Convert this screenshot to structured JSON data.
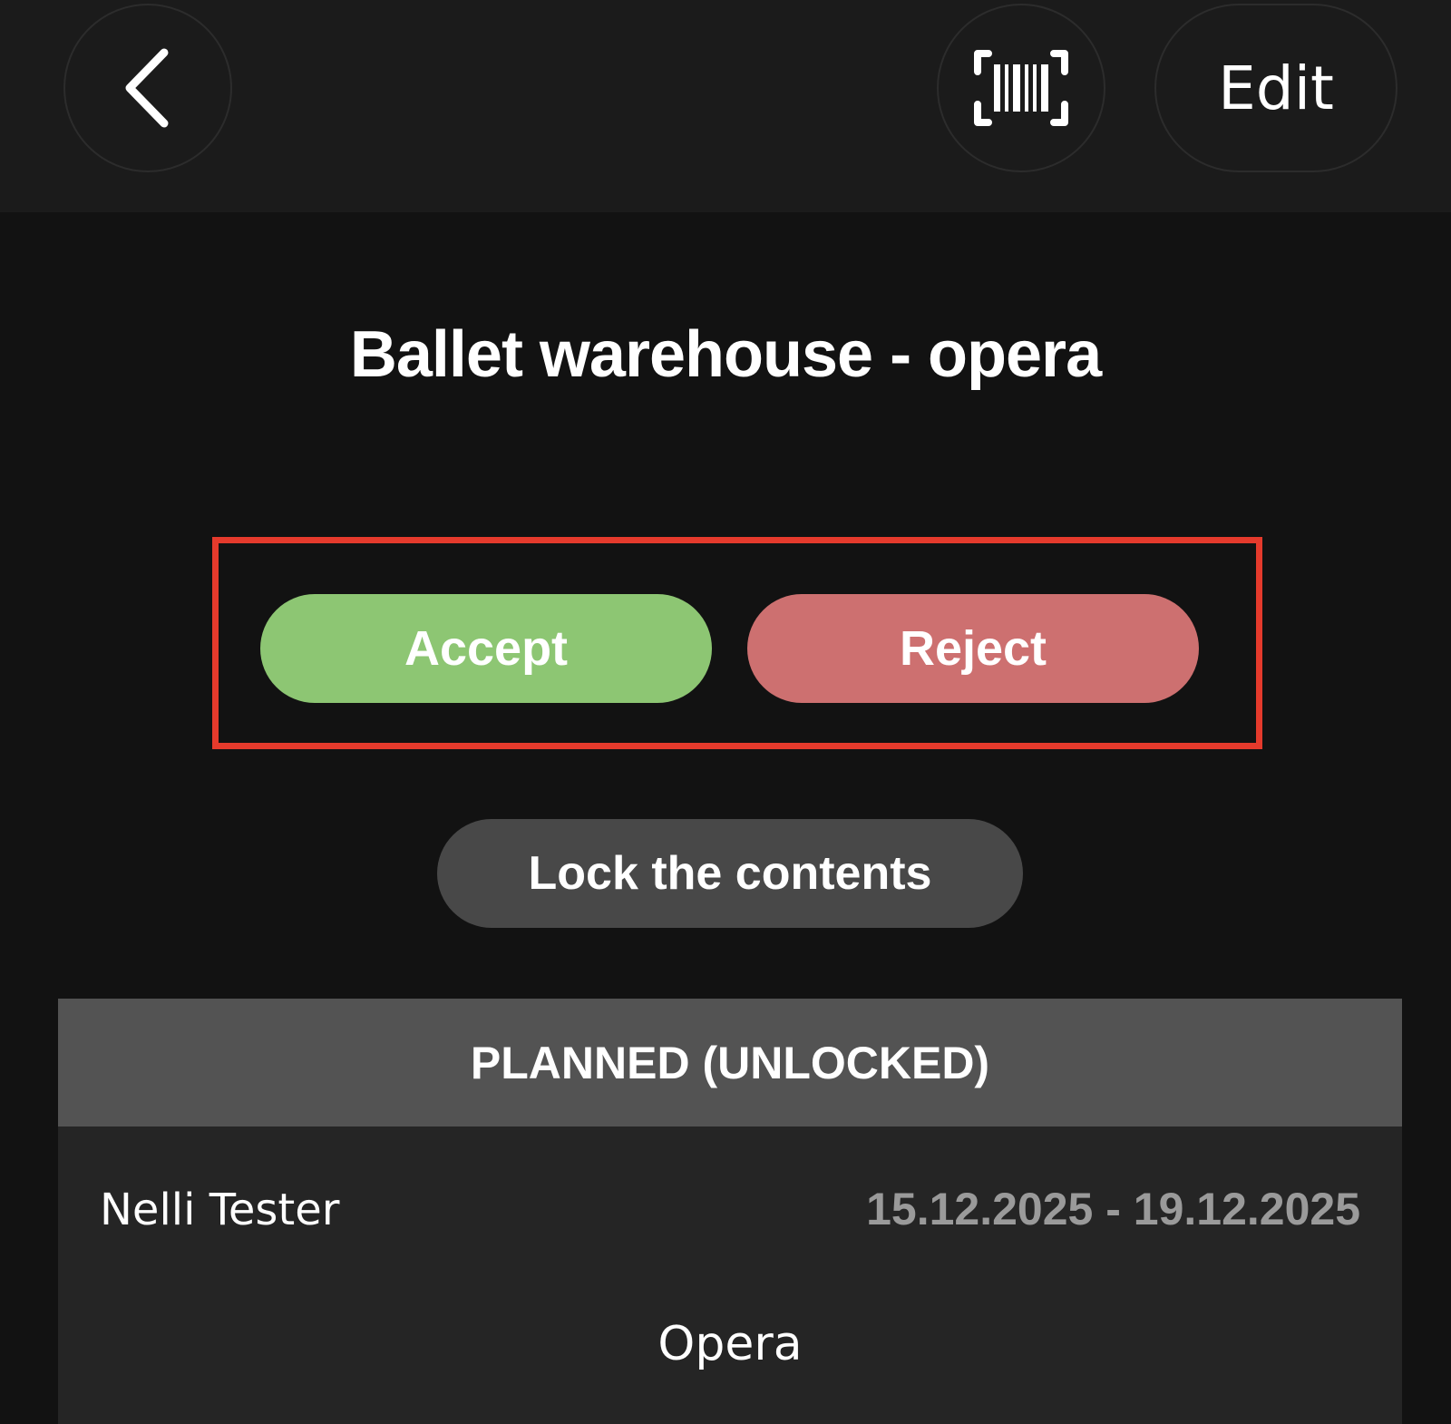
{
  "header": {
    "back_icon": "chevron-left-icon",
    "scan_icon": "barcode-scan-icon",
    "edit_label": "Edit"
  },
  "title": "Ballet warehouse - opera",
  "actions": {
    "accept_label": "Accept",
    "reject_label": "Reject",
    "lock_label": "Lock the contents"
  },
  "card": {
    "status": "PLANNED (UNLOCKED)",
    "person": "Nelli Tester",
    "date_range": "15.12.2025 - 19.12.2025",
    "location": "Opera"
  },
  "colors": {
    "accept": "#8dc673",
    "reject": "#cd7070",
    "highlight": "#e53a2c",
    "background": "#121212"
  }
}
